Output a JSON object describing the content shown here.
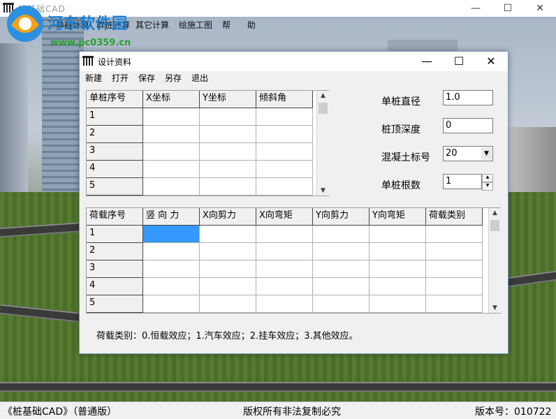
{
  "app": {
    "title": "桩基础CAD",
    "window_buttons": {
      "minimize": "—",
      "maximize": "☐",
      "close": "✕"
    },
    "menu": [
      "基",
      "单桩计算",
      "群桩计算",
      "其它计算",
      "绘施工图",
      "帮",
      "助"
    ]
  },
  "watermark": {
    "site": "河东软件园",
    "url": "www.pc0359.cn"
  },
  "dialog": {
    "title": "设计资料",
    "buttons": {
      "minimize": "—",
      "maximize": "☐",
      "close": "✕"
    },
    "menu": [
      "新建",
      "打开",
      "保存",
      "另存",
      "退出"
    ],
    "pile_grid": {
      "headers": [
        "单桩序号",
        "X坐标",
        "Y坐标",
        "倾斜角"
      ],
      "rows": [
        "1",
        "2",
        "3",
        "4",
        "5"
      ]
    },
    "load_grid": {
      "headers": [
        "荷载序号",
        "竖 向 力",
        "X向剪力",
        "X向弯矩",
        "Y向剪力",
        "Y向弯矩",
        "荷载类别"
      ],
      "rows": [
        "1",
        "2",
        "3",
        "4",
        "5"
      ]
    },
    "form": {
      "diameter_label": "单桩直径",
      "diameter_value": "1.0",
      "top_depth_label": "桩顶深度",
      "top_depth_value": "0",
      "concrete_label": "混凝土标号",
      "concrete_value": "20",
      "count_label": "单桩根数",
      "count_value": "1"
    },
    "note": "荷载类别：0.恒载效应；1.汽车效应；2.挂车效应；3.其他效应。"
  },
  "status": {
    "left": "《桩基础CAD》（普通版）",
    "center": "版权所有非法复制必究",
    "right": "版本号：010722"
  }
}
